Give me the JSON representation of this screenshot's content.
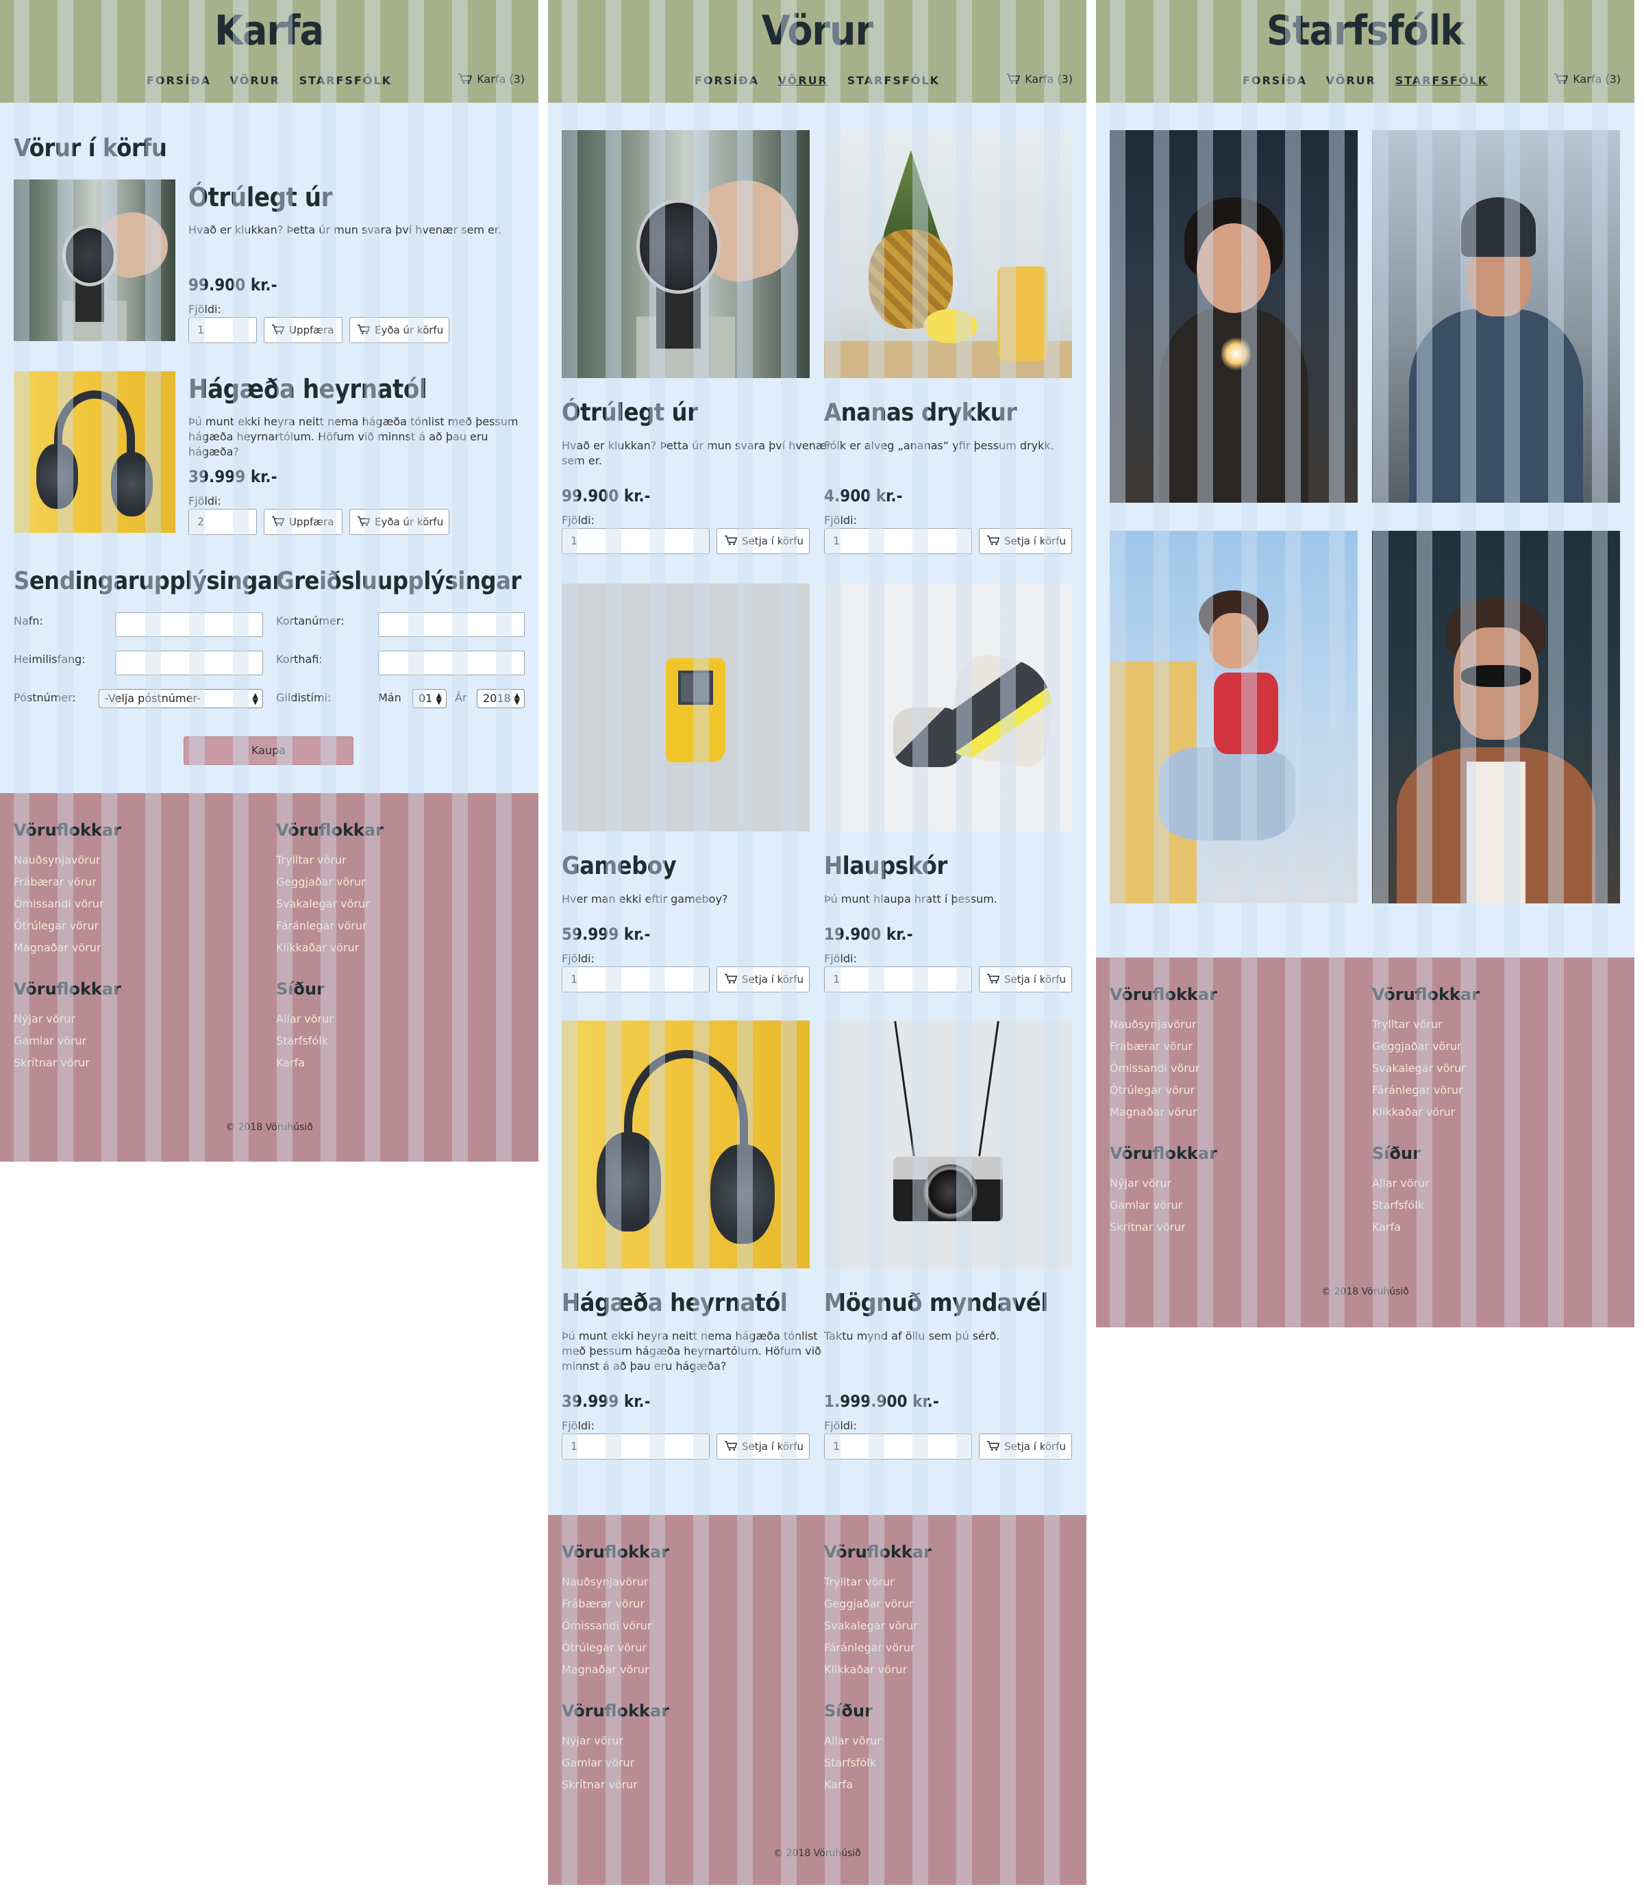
{
  "nav": {
    "home": "FORSÍÐA",
    "products": "VÖRUR",
    "staff": "STARFSFÓLK",
    "cart": "Karfa (3)"
  },
  "cart_page": {
    "title": "Karfa",
    "section_title": "Vörur í körfu",
    "items": [
      {
        "name": "Ótrúlegt úr",
        "desc": "Hvað er klukkan? Þetta úr mun svara því hvenær sem er.",
        "price": "99.900 kr.-",
        "qty_label": "Fjöldi:",
        "qty": "1",
        "update": "Uppfæra",
        "remove": "Eyða úr körfu"
      },
      {
        "name": "Hágæða heyrnatól",
        "desc_1": "Þú munt ekki heyra neitt nema hágæða tónlist með þessum",
        "desc_2": "hágæða heyrnartólum. Höfum við minnst á að þau eru hágæða?",
        "price": "39.999 kr.-",
        "qty_label": "Fjöldi:",
        "qty": "2",
        "update": "Uppfæra",
        "remove": "Eyða úr körfu"
      }
    ],
    "shipping": {
      "title": "Sendingarupplýsingar",
      "name_label": "Nafn:",
      "address_label": "Heimilisfang:",
      "postcode_label": "Póstnúmer:",
      "postcode_value": "-Velja póstnúmer-"
    },
    "payment": {
      "title": "Greiðsluupplýsingar",
      "card_label": "Kortanúmer:",
      "holder_label": "Korthafi:",
      "expiry_label": "Gildistími:",
      "month_label": "Mán",
      "month_value": "01",
      "year_label": "Ár",
      "year_value": "2018"
    },
    "buy": "Kaupa"
  },
  "products_page": {
    "title": "Vörur",
    "qty_label": "Fjöldi:",
    "add_label": "Setja í körfu",
    "products": [
      {
        "name": "Ótrúlegt úr",
        "desc_1": "Hvað er klukkan? Þetta úr mun svara því hvenær",
        "desc_2": "sem er.",
        "price": "99.900 kr.-",
        "qty": "1"
      },
      {
        "name": "Ananas drykkur",
        "desc_1": "Fólk er alveg „ananas“ yfir þessum drykk.",
        "desc_2": "",
        "price": "4.900 kr.-",
        "qty": "1"
      },
      {
        "name": "Gameboy",
        "desc_1": "Hver man ekki eftir gameboy?",
        "desc_2": "",
        "price": "59.999 kr.-",
        "qty": "1"
      },
      {
        "name": "Hlaupskór",
        "desc_1": "Þú munt hlaupa hratt í þessum.",
        "desc_2": "",
        "price": "19.900 kr.-",
        "qty": "1"
      },
      {
        "name": "Hágæða heyrnatól",
        "desc_1": "Þú munt ekki heyra neitt nema hágæða tónlist",
        "desc_2": "með þessum hágæða heyrnartólum. Höfum við",
        "desc_3": "minnst á að þau eru hágæða?",
        "price": "39.999 kr.-",
        "qty": "1"
      },
      {
        "name": "Mögnuð myndavél",
        "desc_1": "Taktu mynd af öllu sem þú sérð.",
        "desc_2": "",
        "price": "1.999.900 kr.-",
        "qty": "1"
      }
    ]
  },
  "staff_page": {
    "title": "Starfsfólk"
  },
  "footer": {
    "col1_title": "Vöruflokkar",
    "col1_items": [
      "Nauðsynjavörur",
      "Frábærar vörur",
      "Ómissandi vörur",
      "Ótrúlegar vörur",
      "Magnaðar vörur"
    ],
    "col2_title": "Vöruflokkar",
    "col2_items": [
      "Trylltar vörur",
      "Geggjaðar vörur",
      "Svakalegar vörur",
      "Fáránlegar vörur",
      "Klikkaðar vörur"
    ],
    "col3_title": "Vöruflokkar",
    "col3_items": [
      "Nýjar vörur",
      "Gamlar vörur",
      "Skrítnar vörur"
    ],
    "col4_title": "Síður",
    "col4_items": [
      "Allar vörur",
      "Starfsfólk",
      "Karfa"
    ],
    "copyright": "© 2018 Vöruhúsið"
  },
  "colors": {
    "header": "#a6b08a",
    "content_bg": "#dfeefa",
    "footer": "#b88c92",
    "buy_button": "#c79aa4",
    "text_dark": "#1f2d33"
  },
  "icons": {
    "cart": "shopping-cart-icon"
  }
}
